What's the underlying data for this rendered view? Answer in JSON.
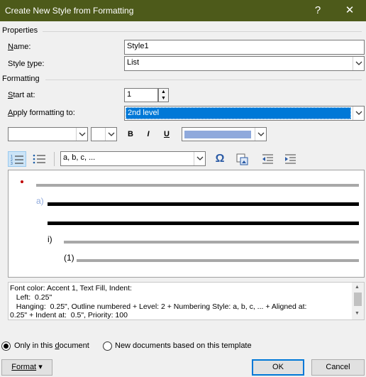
{
  "window": {
    "title": "Create New Style from Formatting",
    "help_glyph": "?",
    "close_glyph": "✕"
  },
  "properties": {
    "heading": "Properties",
    "name_label": "Name:",
    "name_value": "Style1",
    "style_type_label": "Style type:",
    "style_type_value": "List"
  },
  "formatting": {
    "heading": "Formatting",
    "start_at_label": "Start at:",
    "start_at_value": "1",
    "apply_to_label": "Apply formatting to:",
    "apply_to_value": "2nd level",
    "font_name_value": "",
    "font_size_value": "",
    "bold_glyph": "B",
    "italic_glyph": "I",
    "underline_glyph": "U",
    "font_color": "#8fa9dc",
    "numbering_style_value": "a, b, c, ...",
    "symbol_glyph": "Ω"
  },
  "preview": {
    "level2_marker": "a)",
    "level3_marker": "i)",
    "level4_marker": "(1)",
    "bullet_color": "#c00000",
    "accent_color": "#8fa9dc"
  },
  "description": {
    "lines": [
      "Font color: Accent 1, Text Fill, Indent:",
      "   Left:  0.25\"",
      "   Hanging:  0.25\", Outline numbered + Level: 2 + Numbering Style: a, b, c, ... + Aligned at:",
      "0.25\" + Indent at:  0.5\", Priority: 100"
    ]
  },
  "options": {
    "only_in_document_label": "Only in this document",
    "new_documents_label": "New documents based on this template",
    "selected": "only_in_document"
  },
  "buttons": {
    "format_label": "Format",
    "format_arrow": "▾",
    "ok_label": "OK",
    "cancel_label": "Cancel"
  }
}
